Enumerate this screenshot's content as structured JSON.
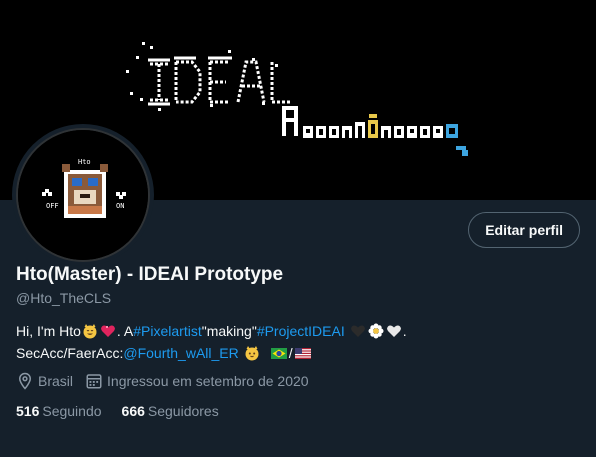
{
  "banner": {
    "logo_text": "IDEAL",
    "subtitle_text": "PROTOTYPE"
  },
  "avatar": {
    "badge_text": "Hto",
    "left_label": "OFF",
    "right_label": "ON"
  },
  "profile": {
    "edit_label": "Editar perfil",
    "name": "Hto(Master) - IDEAI Prototype",
    "handle": "@Hto_TheCLS"
  },
  "bio": {
    "line1_intro": "Hi, I'm Hto ",
    "line1_a": ". A ",
    "hashtag1": "#Pixelartist",
    "line1_making": " \"making\" ",
    "hashtag2": "#ProjectIDEAI",
    "line1_end": ".",
    "line2_intro": "SecAcc/FaerAcc: ",
    "mention": "@Fourth_wAll_ER",
    "line2_slash": "/"
  },
  "meta": {
    "location": "Brasil",
    "joined": "Ingressou em setembro de 2020",
    "location_icon": "map-pin-icon",
    "calendar_icon": "calendar-icon"
  },
  "stats": {
    "following_count": "516",
    "following_label": "Seguindo",
    "followers_count": "666",
    "followers_label": "Seguidores"
  },
  "colors": {
    "background": "#15202b",
    "accent": "#1d9bf0",
    "secondary_text": "#8b98a5",
    "banner_accent": "#3da5e0",
    "banner_yellow": "#e8c84a"
  }
}
